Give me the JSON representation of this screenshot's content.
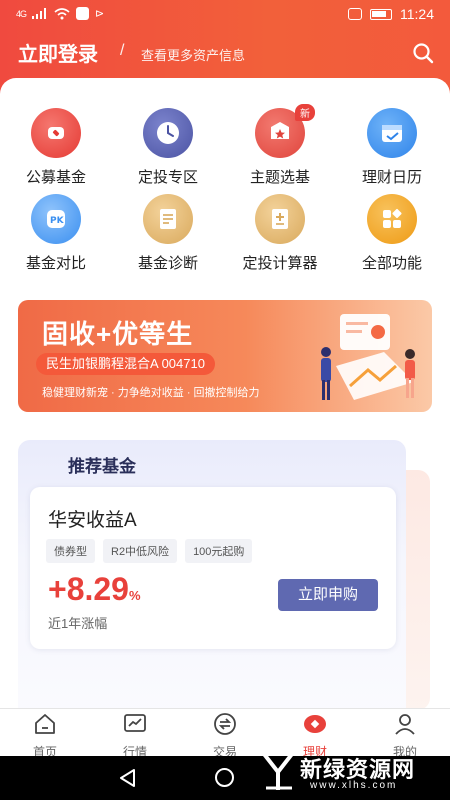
{
  "status": {
    "signal": "4G",
    "time": "11:24"
  },
  "header": {
    "login": "立即登录",
    "separator": "/",
    "subtitle": "查看更多资产信息"
  },
  "grid": [
    {
      "label": "公募基金",
      "icon": "fund-icon",
      "color": "#e8413b"
    },
    {
      "label": "定投专区",
      "icon": "clock-icon",
      "color": "#5b63b3"
    },
    {
      "label": "主题选基",
      "icon": "theme-icon",
      "color": "#e8413b",
      "badge": "新"
    },
    {
      "label": "理财日历",
      "icon": "calendar-icon",
      "color": "#3a8ff0"
    },
    {
      "label": "基金对比",
      "icon": "compare-icon",
      "color": "#3a8ff0"
    },
    {
      "label": "基金诊断",
      "icon": "diagnose-icon",
      "color": "#d9a95c"
    },
    {
      "label": "定投计算器",
      "icon": "calculator-icon",
      "color": "#d9a95c"
    },
    {
      "label": "全部功能",
      "icon": "all-features-icon",
      "color": "#f0a21e"
    }
  ],
  "banner": {
    "title": "固收+优等生",
    "fund": "民生加银鹏程混合A 004710",
    "slogan": "稳健理财新宠 · 力争绝对收益 · 回撤控制给力"
  },
  "recommend": {
    "title": "推荐基金",
    "fund_name": "华安收益A",
    "tags": [
      "债券型",
      "R2中低风险",
      "100元起购"
    ],
    "rate": "+8.29",
    "rate_unit": "%",
    "rate_label": "近1年涨幅",
    "buy_label": "立即申购"
  },
  "tabs": [
    {
      "label": "首页",
      "icon": "home-icon"
    },
    {
      "label": "行情",
      "icon": "chart-icon"
    },
    {
      "label": "交易",
      "icon": "exchange-icon"
    },
    {
      "label": "理财",
      "icon": "wealth-icon",
      "active": true
    },
    {
      "label": "我的",
      "icon": "user-icon"
    }
  ],
  "watermark": {
    "text": "新绿资源网",
    "url": "www.xlhs.com"
  }
}
